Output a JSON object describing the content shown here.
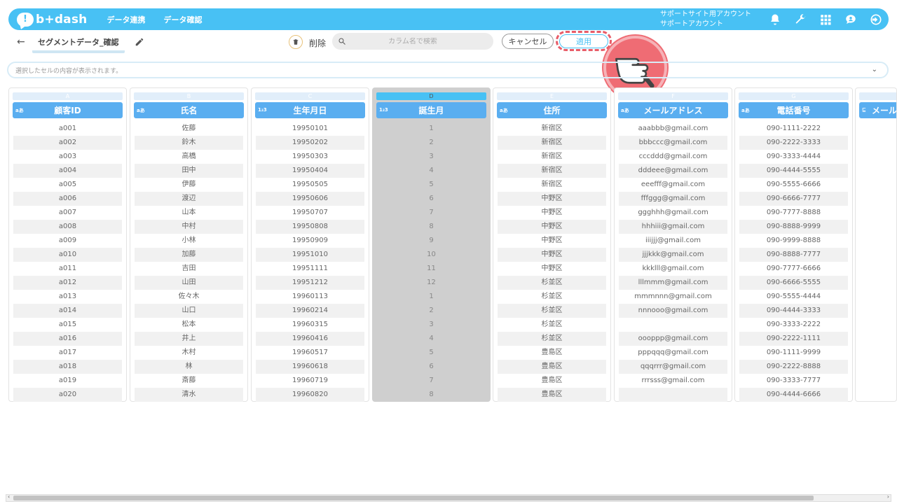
{
  "header": {
    "logo_mark": "!",
    "logo_text": "b+dash",
    "nav": [
      "データ連携",
      "データ確認"
    ],
    "account_line1": "サポートサイト用アカウント",
    "account_line2": "サポートアカウント",
    "icons": [
      "bell-icon",
      "wrench-icon",
      "grid-icon",
      "user-bubble-icon",
      "logout-icon"
    ]
  },
  "toolbar": {
    "back": "←",
    "title": "セグメントデータ_確認",
    "delete_label": "削除",
    "search_placeholder": "カラム名で検索",
    "cancel_label": "キャンセル",
    "apply_label": "適用"
  },
  "cell_display": {
    "placeholder": "選択したセルの内容が表示されます。",
    "chevron": "⌄"
  },
  "columns": [
    {
      "letter": "A",
      "type": "aあ",
      "name": "顧客ID",
      "values": [
        "a001",
        "a002",
        "a003",
        "a004",
        "a005",
        "a006",
        "a007",
        "a008",
        "a009",
        "a010",
        "a011",
        "a012",
        "a013",
        "a014",
        "a015",
        "a016",
        "a017",
        "a018",
        "a019",
        "a020"
      ]
    },
    {
      "letter": "B",
      "type": "aあ",
      "name": "氏名",
      "values": [
        "佐藤",
        "鈴木",
        "高橋",
        "田中",
        "伊藤",
        "渡辺",
        "山本",
        "中村",
        "小林",
        "加藤",
        "吉田",
        "山田",
        "佐々木",
        "山口",
        "松本",
        "井上",
        "木村",
        "林",
        "斎藤",
        "清水"
      ]
    },
    {
      "letter": "C",
      "type": "1₂3",
      "name": "生年月日",
      "values": [
        "19950101",
        "19950202",
        "19950303",
        "19950404",
        "19950505",
        "19950606",
        "19950707",
        "19950808",
        "19950909",
        "19951010",
        "19951111",
        "19951212",
        "19960113",
        "19960214",
        "19960315",
        "19960416",
        "19960517",
        "19960618",
        "19960719",
        "19960820"
      ]
    },
    {
      "letter": "D",
      "type": "1₂3",
      "name": "誕生月",
      "values": [
        "1",
        "2",
        "3",
        "4",
        "5",
        "6",
        "7",
        "8",
        "9",
        "10",
        "11",
        "12",
        "1",
        "2",
        "3",
        "4",
        "5",
        "6",
        "7",
        "8"
      ]
    },
    {
      "letter": "E",
      "type": "aあ",
      "name": "住所",
      "values": [
        "新宿区",
        "新宿区",
        "新宿区",
        "新宿区",
        "新宿区",
        "中野区",
        "中野区",
        "中野区",
        "中野区",
        "中野区",
        "中野区",
        "杉並区",
        "杉並区",
        "杉並区",
        "杉並区",
        "杉並区",
        "豊島区",
        "豊島区",
        "豊島区",
        "豊島区"
      ]
    },
    {
      "letter": "F",
      "type": "aあ",
      "name": "メールアドレス",
      "values": [
        "aaabbb@gmail.com",
        "bbbccc@gmail.com",
        "cccddd@gmail.com",
        "dddeee@gmail.com",
        "eeefff@gmail.com",
        "fffggg@gmail.com",
        "ggghhh@gmail.com",
        "hhhiii@gmail.com",
        "iiijjj@gmail.com",
        "jjjkkk@gmail.com",
        "kkklll@gmail.com",
        "lllmmm@gmail.com",
        "mmmnnn@gmail.com",
        "nnnooo@gmail.com",
        "",
        "oooppp@gmail.com",
        "pppqqq@gmail.com",
        "qqqrrr@gmail.com",
        "rrrsss@gmail.com",
        ""
      ]
    },
    {
      "letter": "G",
      "type": "aあ",
      "name": "電話番号",
      "values": [
        "090-1111-2222",
        "090-2222-3333",
        "090-3333-4444",
        "090-4444-5555",
        "090-5555-6666",
        "090-6666-7777",
        "090-7777-8888",
        "090-8888-9999",
        "090-9999-8888",
        "090-8888-7777",
        "090-7777-6666",
        "090-6666-5555",
        "090-5555-4444",
        "090-4444-3333",
        "090-3333-2222",
        "090-2222-1111",
        "090-1111-9999",
        "090-2222-8888",
        "090-3333-7777",
        "090-4444-6666"
      ]
    }
  ],
  "partial_column": {
    "letter": "",
    "type": "⊑",
    "name": "メール"
  },
  "selected_column": "D",
  "colors": {
    "brand": "#48c1f4",
    "column_header": "#5aaef0",
    "highlight": "#e85c68"
  },
  "scrollbar": {
    "left": "‹",
    "right": "›"
  }
}
